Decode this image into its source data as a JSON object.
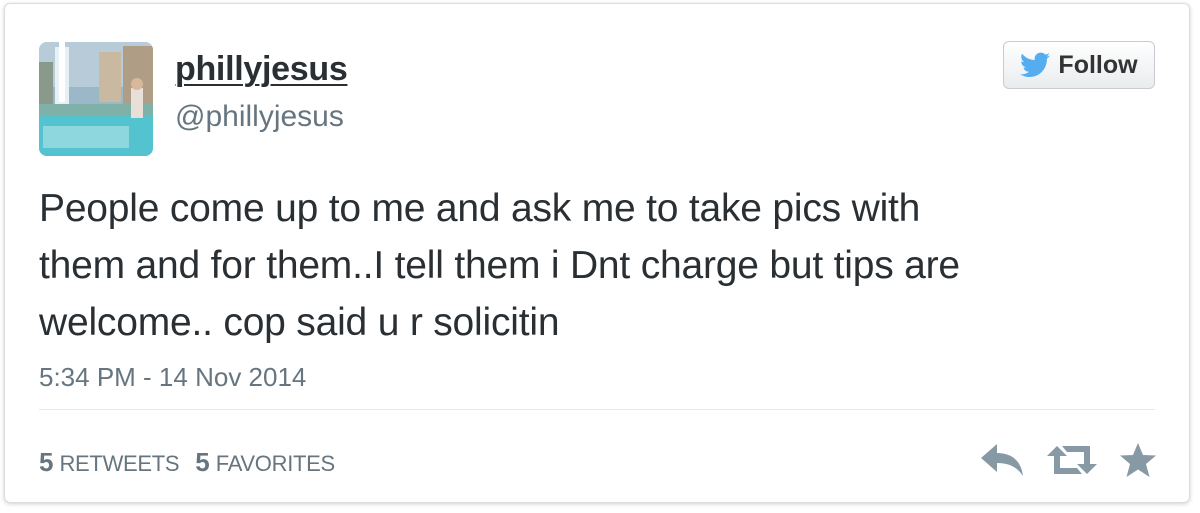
{
  "user": {
    "display_name": "phillyjesus",
    "handle": "@phillyjesus",
    "avatar_icon": "profile-photo"
  },
  "follow_button": {
    "label": "Follow",
    "icon": "twitter-bird-icon",
    "icon_color": "#55acee"
  },
  "tweet": {
    "lines": [
      "People come up to me and ask me to take pics with",
      "them and for them..I tell them i Dnt charge but tips are",
      "welcome.. cop said u r solicitin"
    ],
    "timestamp": "5:34 PM - 14 Nov 2014"
  },
  "stats": {
    "retweets_count": "5",
    "retweets_label": "RETWEETS",
    "favorites_count": "5",
    "favorites_label": "FAVORITES"
  },
  "actions": {
    "reply_icon": "reply-icon",
    "retweet_icon": "retweet-icon",
    "favorite_icon": "star-icon",
    "icon_color": "#8899a6"
  }
}
